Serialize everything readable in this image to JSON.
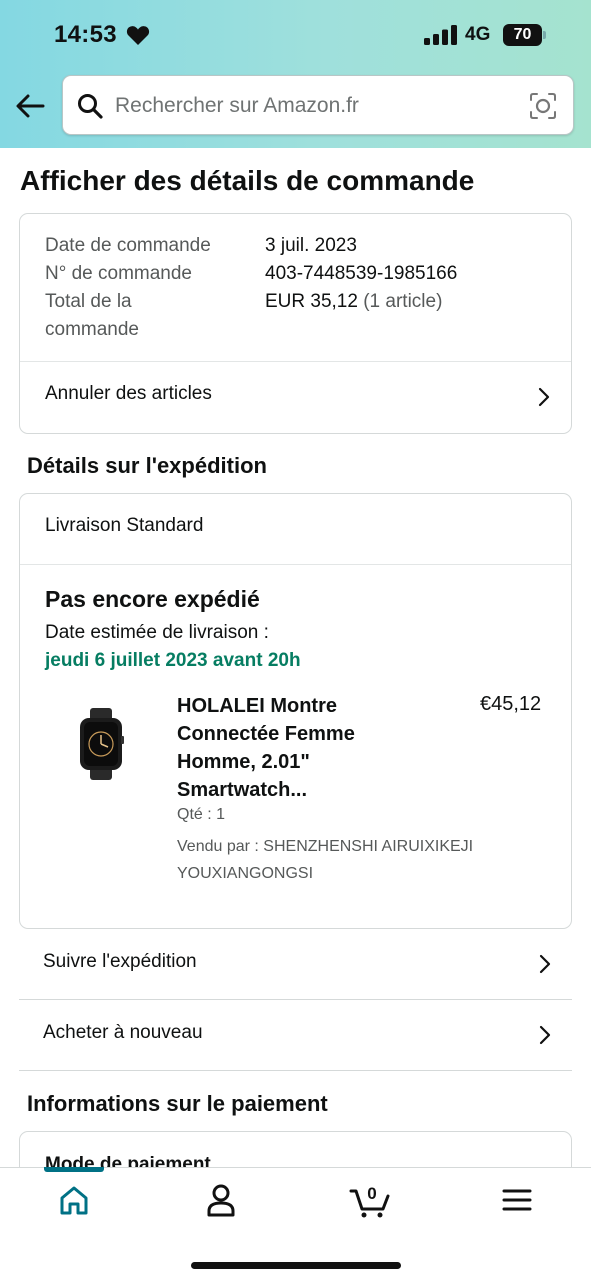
{
  "status_bar": {
    "time": "14:53",
    "network": "4G",
    "battery": "70"
  },
  "search": {
    "placeholder": "Rechercher sur Amazon.fr"
  },
  "page_title": "Afficher des détails de commande",
  "order": {
    "date_label": "Date de commande",
    "date_value": "3 juil. 2023",
    "number_label": "N° de commande",
    "number_value": "403-7448539-1985166",
    "total_label_line1": "Total de la",
    "total_label_line2": "commande",
    "total_value": "EUR 35,12",
    "total_items": "(1 article)",
    "cancel_label": "Annuler des articles"
  },
  "shipping": {
    "section_title": "Détails sur l'expédition",
    "method": "Livraison Standard",
    "status": "Pas encore expédié",
    "estimated_label": "Date estimée de livraison :",
    "estimated_date": "jeudi 6 juillet 2023 avant 20h",
    "product": {
      "title": "HOLALEI Montre Connectée Femme Homme, 2.01\" Smartwatch...",
      "price": "€45,12",
      "quantity": "Qté : 1",
      "seller": "Vendu par : SHENZHENSHI AIRUIXIKEJI YOUXIANGONGSI"
    }
  },
  "actions": {
    "track": "Suivre l'expédition",
    "buy_again": "Acheter à nouveau"
  },
  "payment": {
    "section_title": "Informations sur le paiement",
    "method_label": "Mode de paiement"
  },
  "tabbar": {
    "items": [
      "home-icon",
      "account-icon",
      "cart-icon",
      "menu-icon"
    ],
    "cart_count": "0",
    "active_color": "#007185"
  },
  "colors": {
    "delivery_green": "#067d62",
    "accent_teal": "#007185"
  }
}
